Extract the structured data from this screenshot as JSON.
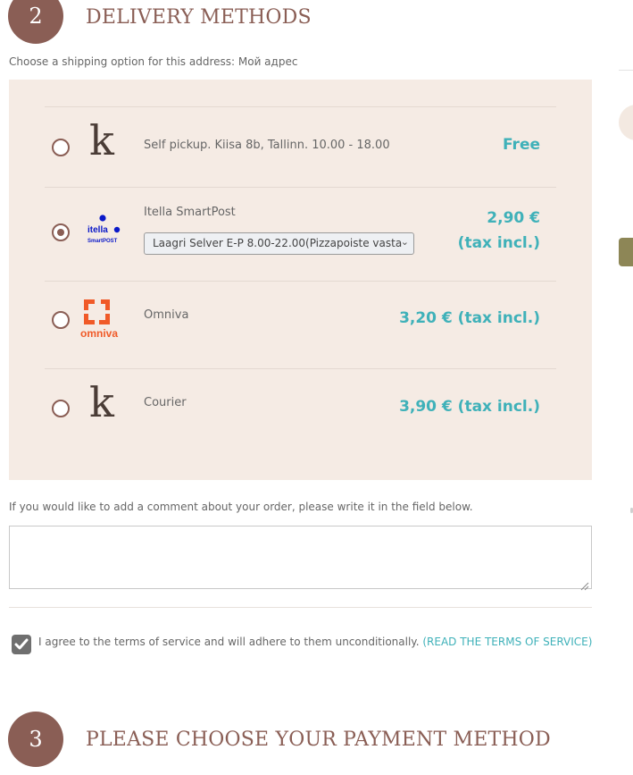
{
  "delivery": {
    "step_number": "2",
    "title": "DELIVERY METHODS",
    "subtitle": "Choose a shipping option for this address: Мой адрес",
    "methods": [
      {
        "label": "Self pickup. Kiisa 8b, Tallinn. 10.00 - 18.00",
        "price": "Free",
        "selected": false,
        "logo": "k-logo-icon"
      },
      {
        "label": "Itella SmartPost",
        "price_line1": "2,90 €",
        "price_line2": "(tax incl.)",
        "selected": true,
        "logo": "itella-smartpost-logo-icon",
        "logo_text": "itella",
        "logo_subtext": "SmartPOST",
        "parcel_machine_selected": "Laagri Selver E-P 8.00-22.00(Pizzapoiste vasta"
      },
      {
        "label": "Omniva",
        "price": "3,20 € (tax incl.)",
        "selected": false,
        "logo": "omniva-logo-icon",
        "logo_text": "omniva"
      },
      {
        "label": "Courier",
        "price": "3,90 € (tax incl.)",
        "selected": false,
        "logo": "k-logo-icon"
      }
    ]
  },
  "comment": {
    "label": "If you would like to add a comment about your order, please write it in the field below.",
    "value": ""
  },
  "terms": {
    "checked": true,
    "text": "I agree to the terms of service and will adhere to them unconditionally.",
    "link": "(READ THE TERMS OF SERVICE)"
  },
  "payment": {
    "step_number": "3",
    "title": "PLEASE CHOOSE YOUR PAYMENT METHOD"
  },
  "colors": {
    "accent": "#8a5e55",
    "price": "#3fb1b9",
    "panel_bg": "#f5ebe4",
    "omniva_orange": "#f05a28",
    "itella_blue": "#0a18c8"
  }
}
